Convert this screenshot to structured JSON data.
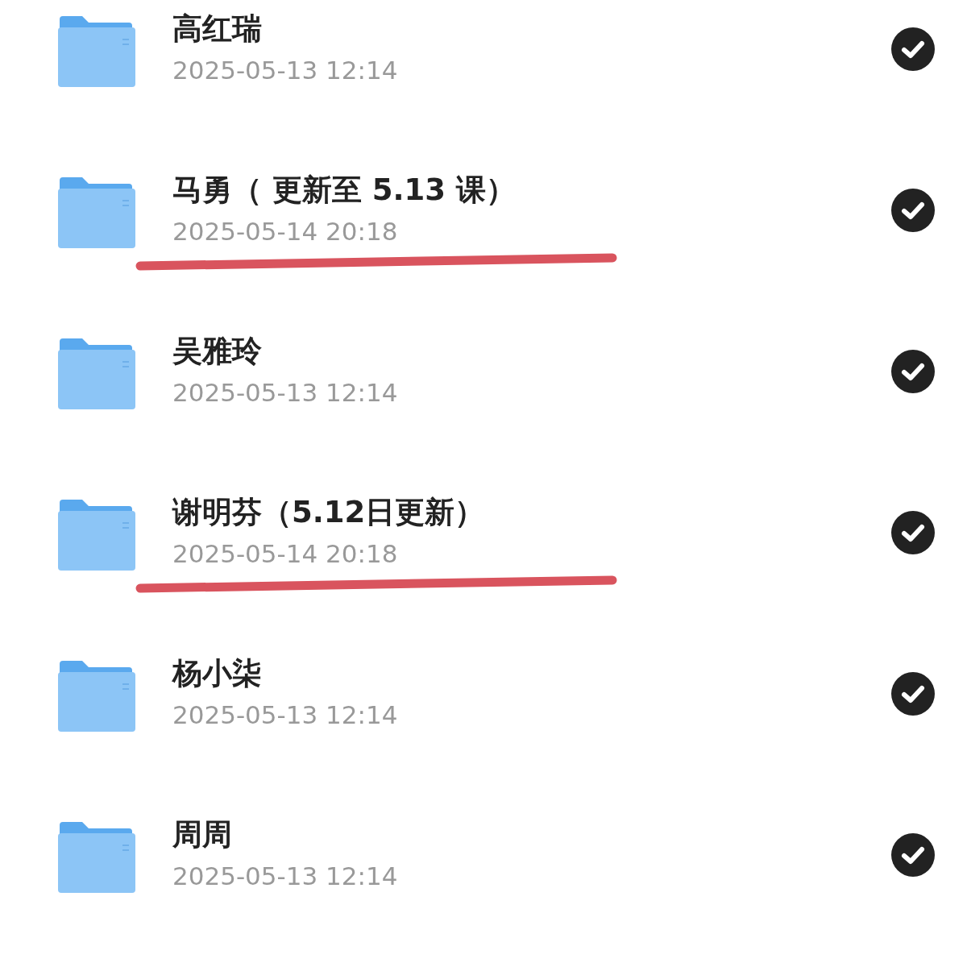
{
  "folders": [
    {
      "name": "高红瑞",
      "date": "2025-05-13 12:14",
      "checked": true,
      "underlined": false
    },
    {
      "name": "马勇（ 更新至 5.13 课）",
      "date": "2025-05-14 20:18",
      "checked": true,
      "underlined": true
    },
    {
      "name": "吴雅玲",
      "date": "2025-05-13 12:14",
      "checked": true,
      "underlined": false
    },
    {
      "name": "谢明芬（5.12日更新）",
      "date": "2025-05-14 20:18",
      "checked": true,
      "underlined": true
    },
    {
      "name": "杨小柒",
      "date": "2025-05-13 12:14",
      "checked": true,
      "underlined": false
    },
    {
      "name": "周周",
      "date": "2025-05-13 12:14",
      "checked": true,
      "underlined": false
    }
  ]
}
